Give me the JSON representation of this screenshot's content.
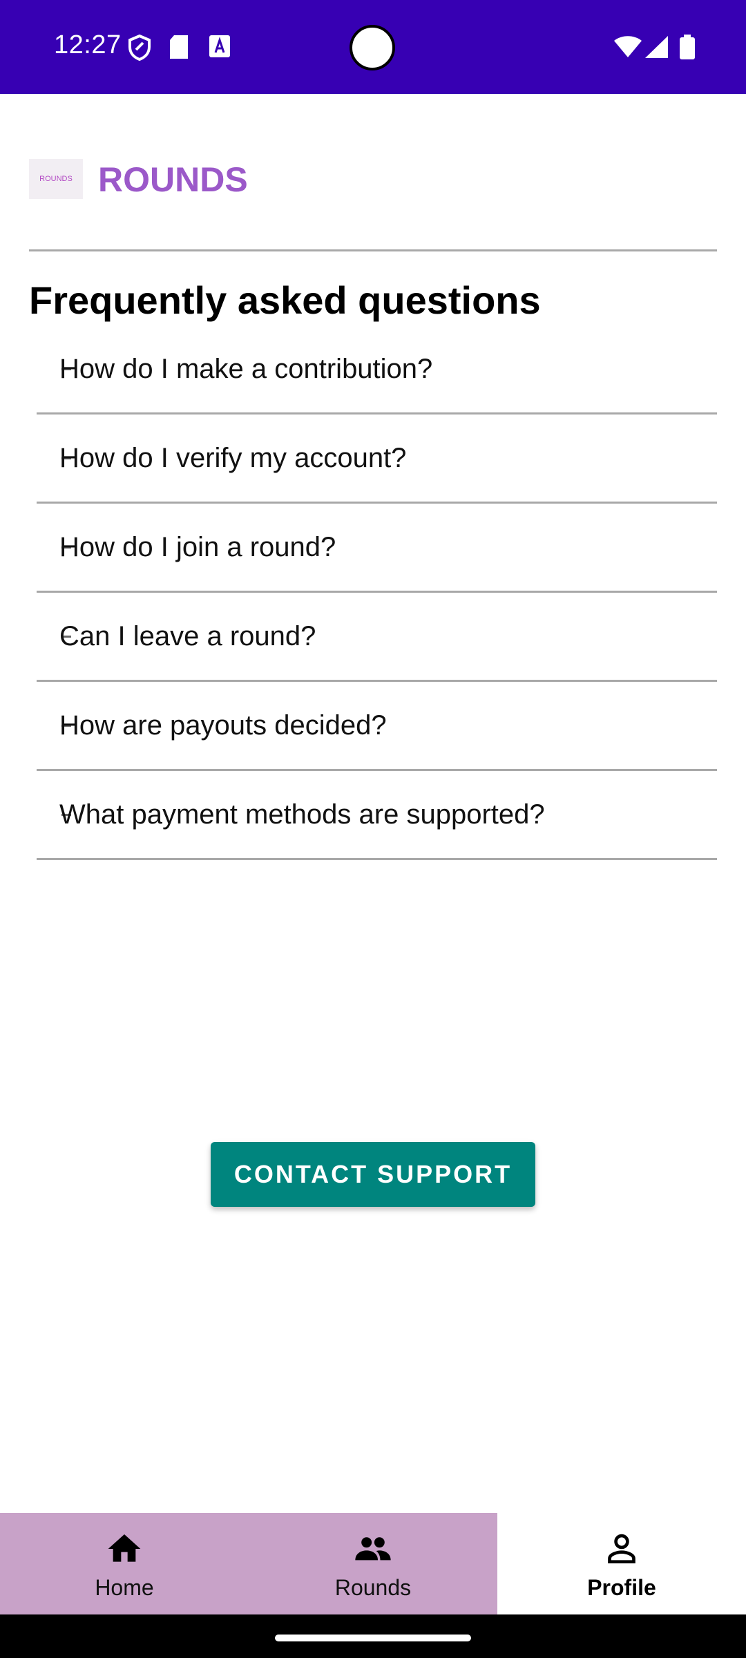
{
  "status_bar": {
    "time": "12:27",
    "left_icons": [
      "shield-icon",
      "sd-card-icon",
      "font-icon"
    ],
    "right_icons": [
      "wifi-icon",
      "signal-icon",
      "battery-icon"
    ],
    "color": "#3700b3"
  },
  "header": {
    "logo_text": "ROUNDS",
    "title": "ROUNDS",
    "title_color": "#9b59c9"
  },
  "faq": {
    "heading": "Frequently asked questions",
    "items": [
      {
        "question": "How do I make a contribution?"
      },
      {
        "question": "How do I verify my account?"
      },
      {
        "question": "How do I join a round?"
      },
      {
        "question": "Can I leave a round?"
      },
      {
        "question": "How are payouts decided?"
      },
      {
        "question": "What payment methods are supported?"
      }
    ]
  },
  "contact": {
    "label": "CONTACT SUPPORT",
    "color": "#00857e"
  },
  "bottom_nav": {
    "items": [
      {
        "label": "Home",
        "icon": "home-icon",
        "active": false
      },
      {
        "label": "Rounds",
        "icon": "group-icon",
        "active": false
      },
      {
        "label": "Profile",
        "icon": "person-icon",
        "active": true
      }
    ],
    "inactive_color": "#c8a2c8"
  }
}
